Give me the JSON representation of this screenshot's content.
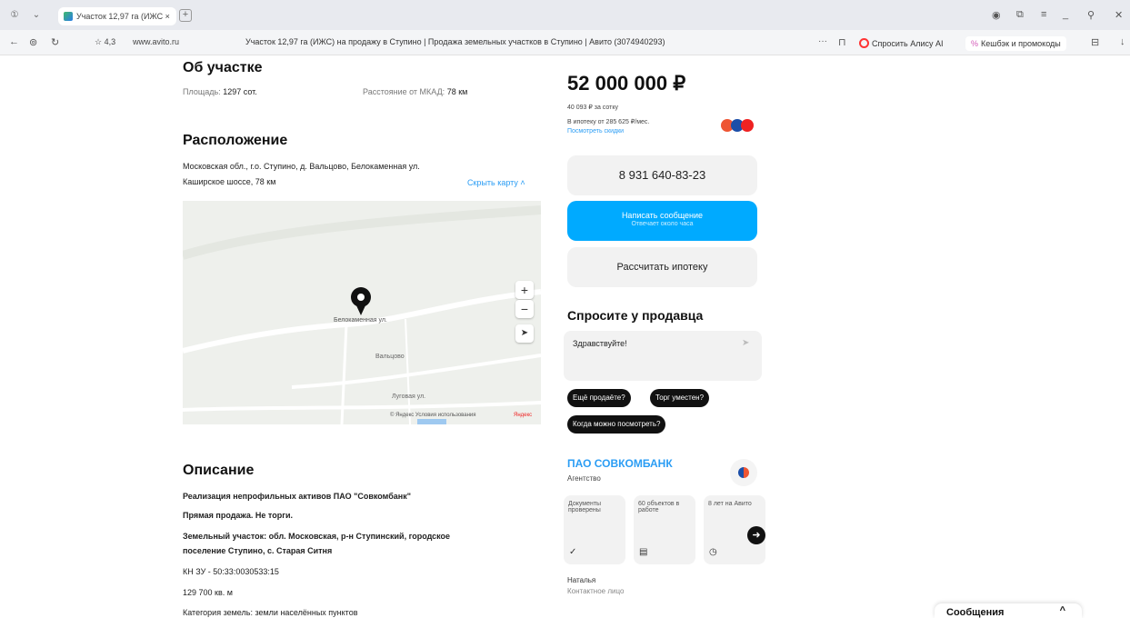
{
  "browser": {
    "tab_title": "Участок 12,97 га (ИЖС ×",
    "new_tab": "+",
    "rating": "☆ 4,3",
    "domain": "www.avito.ru",
    "page_title": "Участок 12,97 га (ИЖС) на продажу в Ступино | Продажа земельных участков в Ступино | Авито (3074940293)",
    "alice_label": "Спросить Алису AI",
    "cashback_label": "Кешбэк и промокоды"
  },
  "about": {
    "heading": "Об участке",
    "area_label": "Площадь:",
    "area_value": "1297 сот.",
    "distance_label": "Расстояние от МКАД:",
    "distance_value": "78 км"
  },
  "location": {
    "heading": "Расположение",
    "address": "Московская обл., г.о. Ступино, д. Вальцово, Белокаменная ул.",
    "highway": "Каширское шоссе, 78 км",
    "hide_map": "Скрыть карту ˄",
    "map_label_street1": "Белокаменная ул.",
    "map_label_village": "Вальцово",
    "map_label_street2": "Луговая ул.",
    "map_terms": "© Яндекс Условия использования",
    "map_brand": "Яндекс",
    "zoom_in": "+",
    "zoom_out": "−",
    "locate": "➤"
  },
  "description": {
    "heading": "Описание",
    "lines": [
      "Реализация непрофильных активов ПАО \"Совкомбанк\"",
      "Прямая продажа. Не торги.",
      "Земельный участок: обл. Московская, р-н Ступинский, городское",
      "поселение Ступино, с. Старая Ситня",
      "КН ЗУ - 50:33:0030533:15",
      "129 700 кв. м",
      "Категория земель: земли населённых пунктов"
    ]
  },
  "pricing": {
    "price": "52 000 000 ₽",
    "per_sotka": "40 093 ₽ за сотку",
    "mortgage": "В ипотеку от 285 625 ₽/мес.",
    "discounts_link": "Посмотреть скидки"
  },
  "actions": {
    "phone": "8 931 640-83-23",
    "write_title": "Написать сообщение",
    "write_sub": "Отвечает около часа",
    "mortgage_calc": "Рассчитать ипотеку"
  },
  "ask": {
    "heading": "Спросите у продавца",
    "message_value": "Здравствуйте!",
    "send_icon": "➤",
    "chips": [
      "Ещё продаёте?",
      "Торг уместен?",
      "Когда можно посмотреть?"
    ]
  },
  "seller": {
    "name": "ПАО СОВКОМБАНК",
    "type": "Агентство",
    "cards": [
      {
        "text": "Документы проверены",
        "icon": "✓"
      },
      {
        "text": "60 объектов в работе",
        "icon": "▤"
      },
      {
        "text": "8 лет на Авито",
        "icon": "◷"
      }
    ],
    "contact_name": "Наталья",
    "contact_role": "Контактное лицо"
  },
  "chat": {
    "label": "Сообщения",
    "chevron": "^"
  },
  "colors": {
    "accent_blue": "#00aaff",
    "link_blue": "#2b9df4"
  }
}
